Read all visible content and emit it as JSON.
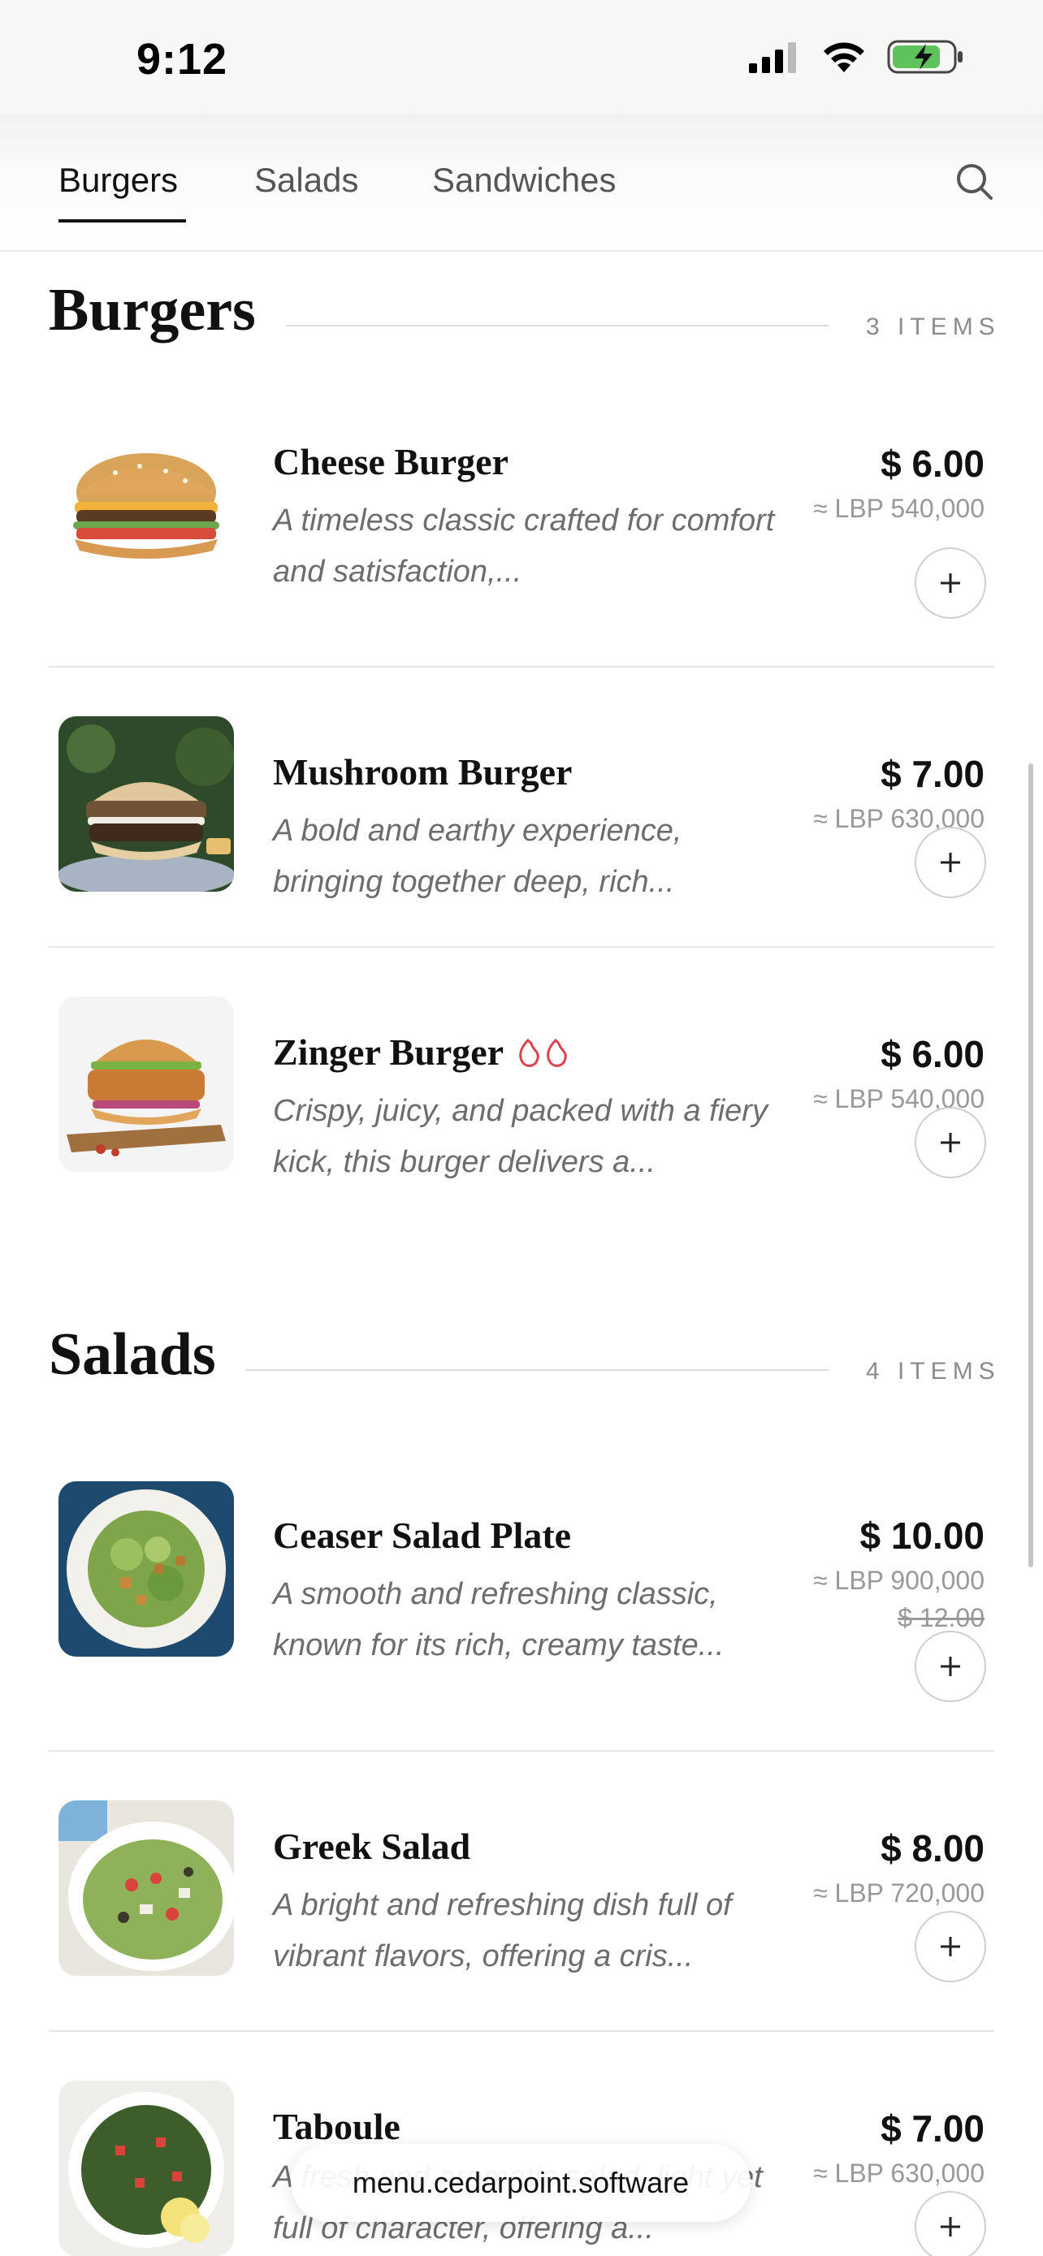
{
  "status_bar": {
    "time": "9:12"
  },
  "nav": {
    "tabs": [
      {
        "label": "Burgers"
      },
      {
        "label": "Salads"
      },
      {
        "label": "Sandwiches"
      }
    ]
  },
  "sections": [
    {
      "title": "Burgers",
      "count": "3 ITEMS",
      "items": [
        {
          "name": "Cheese Burger",
          "desc": "A timeless classic crafted for comfort and satisfaction,...",
          "price": "$ 6.00",
          "lbp": "≈ LBP 540,000",
          "icon": "cheese-burger-image"
        },
        {
          "name": "Mushroom Burger",
          "desc": "A bold and earthy experience, bringing together deep, rich...",
          "price": "$ 7.00",
          "lbp": "≈ LBP 630,000",
          "icon": "mushroom-burger-image"
        },
        {
          "name": "Zinger Burger",
          "desc": "Crispy, juicy, and packed with a fiery kick, this burger delivers a...",
          "price": "$ 6.00",
          "lbp": "≈ LBP 540,000",
          "icon": "zinger-burger-image",
          "spicy": true
        }
      ]
    },
    {
      "title": "Salads",
      "count": "4 ITEMS",
      "items": [
        {
          "name": "Ceaser Salad Plate",
          "desc": "A smooth and refreshing classic, known for its rich, creamy taste...",
          "price": "$ 10.00",
          "lbp": "≈ LBP 900,000",
          "old_price": "$ 12.00",
          "icon": "caesar-salad-image"
        },
        {
          "name": "Greek Salad",
          "desc": "A bright and refreshing dish full of vibrant flavors, offering a cris...",
          "price": "$ 8.00",
          "lbp": "≈ LBP 720,000",
          "icon": "greek-salad-image"
        },
        {
          "name": "Taboule",
          "desc": "A fresh and aromatic salad, light yet full of character, offering a...",
          "price": "$ 7.00",
          "lbp": "≈ LBP 630,000",
          "icon": "taboule-image"
        }
      ]
    }
  ],
  "url_bar": {
    "url": "menu.cedarpoint.software"
  }
}
